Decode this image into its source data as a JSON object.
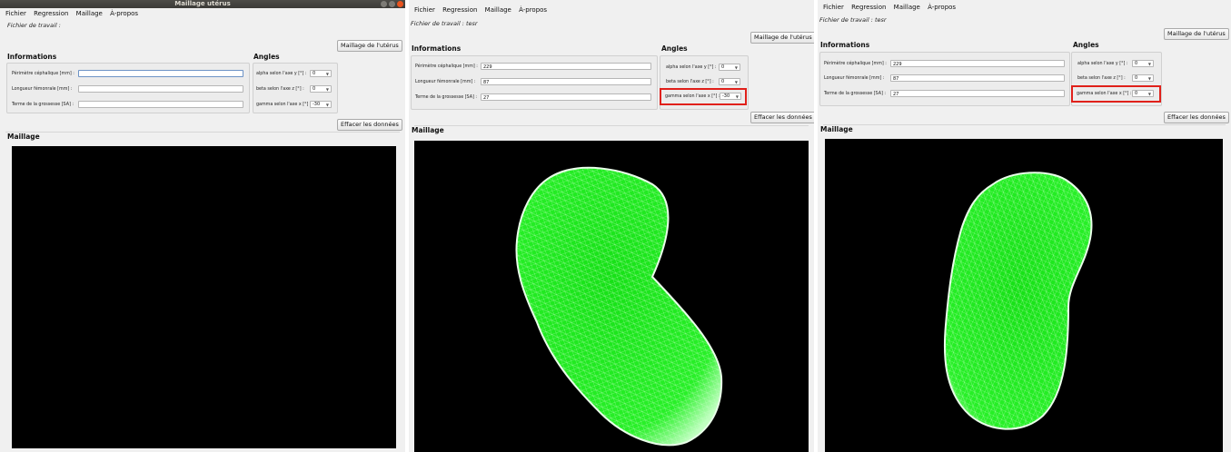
{
  "window": {
    "title": "Maillage utérus"
  },
  "menu": [
    "Fichier",
    "Regression",
    "Maillage",
    "À-propos"
  ],
  "labels": {
    "informations": "Informations",
    "angles": "Angles",
    "maillage": "Maillage",
    "maillage_button": "Maillage de l'utérus",
    "effacer_button": "Effacer les données",
    "perimetre": "Périmètre céphalique [mm] :",
    "longueur": "Longueur fémonrale [mm] :",
    "terme": "Terme de la grossesse [SA] :",
    "alpha": "alpha selon l'axe y [°] :",
    "beta": "beta selon l'axe z [°] :",
    "gamma": "gamma selon l'axe x [°] :"
  },
  "panels": [
    {
      "work_file": "Fichier de travail :",
      "perimetre": "",
      "longueur": "",
      "terme": "",
      "alpha": "0",
      "beta": "0",
      "gamma": "-30",
      "highlight_gamma": false,
      "mesh_visible": false
    },
    {
      "work_file": "Fichier de travail : tesr",
      "perimetre": "229",
      "longueur": "87",
      "terme": "27",
      "alpha": "0",
      "beta": "0",
      "gamma": "-30",
      "highlight_gamma": true,
      "mesh_visible": true
    },
    {
      "work_file": "Fichier de travail : tesr",
      "perimetre": "229",
      "longueur": "87",
      "terme": "27",
      "alpha": "0",
      "beta": "0",
      "gamma": "0",
      "highlight_gamma": true,
      "mesh_visible": true
    }
  ],
  "colors": {
    "mesh": "#1ee81e",
    "viewport": "#000000",
    "highlight": "#e0201a"
  }
}
